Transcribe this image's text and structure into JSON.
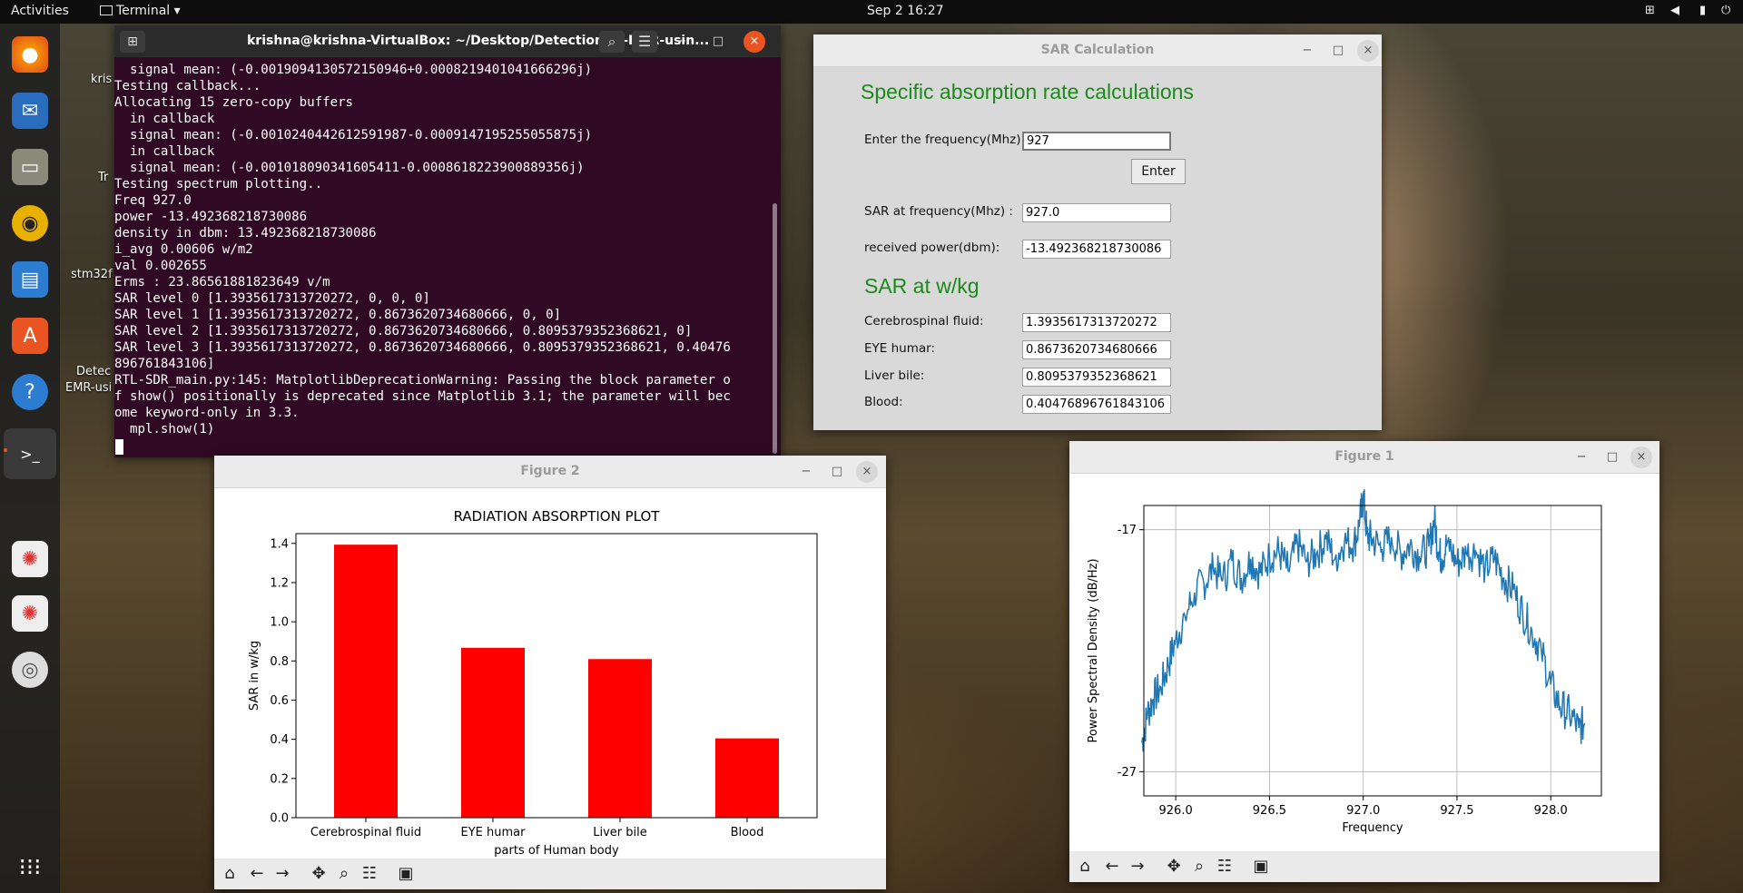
{
  "topbar": {
    "activities": "Activities",
    "app": "Terminal ▾",
    "clock": "Sep 2  16:27"
  },
  "desktop_icons": [
    {
      "label": "kris"
    },
    {
      "label": "Tr"
    },
    {
      "label": "stm32f"
    },
    {
      "label": "Detec"
    },
    {
      "label": "EMR-usi"
    }
  ],
  "terminal": {
    "title": "krishna@krishna-VirtualBox: ~/Desktop/Detection-of-EMR-usin...",
    "lines": [
      "  signal mean: (-0.0019094130572150946+0.0008219401041666296j)",
      "Testing callback...",
      "Allocating 15 zero-copy buffers",
      "  in callback",
      "  signal mean: (-0.0010240442612591987-0.0009147195255055875j)",
      "  in callback",
      "  signal mean: (-0.001018090341605411-0.0008618223900889356j)",
      "Testing spectrum plotting..",
      "Freq 927.0",
      "power -13.492368218730086",
      "density in dbm: 13.492368218730086",
      "i_avg 0.00606 w/m2",
      "val 0.002655",
      "Erms : 23.86561881823649 v/m",
      "SAR level 0 [1.3935617313720272, 0, 0, 0]",
      "SAR level 1 [1.3935617313720272, 0.8673620734680666, 0, 0]",
      "SAR level 2 [1.3935617313720272, 0.8673620734680666, 0.8095379352368621, 0]",
      "SAR level 3 [1.3935617313720272, 0.8673620734680666, 0.8095379352368621, 0.40476",
      "896761843106]",
      "RTL-SDR_main.py:145: MatplotlibDeprecationWarning: Passing the block parameter o",
      "f show() positionally is deprecated since Matplotlib 3.1; the parameter will bec",
      "ome keyword-only in 3.3.",
      "  mpl.show(1)"
    ]
  },
  "sar_window": {
    "title": "SAR Calculation",
    "heading": "Specific absorption rate calculations",
    "freq_label": "Enter the frequency(Mhz):",
    "freq_value": "927",
    "enter_button": "Enter",
    "sar_freq_label": "SAR at frequency(Mhz) :",
    "sar_freq_value": "927.0",
    "power_label": "received power(dbm):",
    "power_value": "-13.492368218730086",
    "subheading": "SAR at w/kg",
    "rows": [
      {
        "label": "Cerebrospinal fluid:",
        "value": "1.3935617313720272"
      },
      {
        "label": "EYE humar:",
        "value": "0.8673620734680666"
      },
      {
        "label": "Liver bile:",
        "value": "0.8095379352368621"
      },
      {
        "label": "Blood:",
        "value": "0.40476896761843106"
      }
    ]
  },
  "figure2": {
    "title": "Figure 2"
  },
  "figure1": {
    "title": "Figure 1"
  },
  "chart_data": [
    {
      "type": "bar",
      "title": "RADIATION ABSORPTION PLOT",
      "xlabel": "parts of Human body",
      "ylabel": "SAR in w/kg",
      "categories": [
        "Cerebrospinal fluid",
        "EYE humar",
        "Liver bile",
        "Blood"
      ],
      "values": [
        1.3935617313720272,
        0.8673620734680666,
        0.8095379352368621,
        0.40476896761843106
      ],
      "ylim": [
        0,
        1.45
      ],
      "yticks": [
        "0.0",
        "0.2",
        "0.4",
        "0.6",
        "0.8",
        "1.0",
        "1.2",
        "1.4"
      ],
      "bar_color": "#ff0000",
      "grid": false
    },
    {
      "type": "line",
      "title": "",
      "xlabel": "Frequency",
      "ylabel": "Power Spectral Density (dB/Hz)",
      "xlim": [
        925.83,
        928.27
      ],
      "ylim": [
        -28.0,
        -16.0
      ],
      "xticks": [
        "926.0",
        "926.5",
        "927.0",
        "927.5",
        "928.0"
      ],
      "yticks": [
        "-17",
        "-27"
      ],
      "line_color": "#1f77b4",
      "grid": true,
      "x": [
        925.82,
        925.85,
        925.88,
        925.92,
        925.96,
        926.0,
        926.05,
        926.1,
        926.15,
        926.2,
        926.25,
        926.3,
        926.35,
        926.4,
        926.45,
        926.5,
        926.55,
        926.6,
        926.65,
        926.7,
        926.75,
        926.8,
        926.85,
        926.9,
        926.95,
        926.98,
        927.0,
        927.02,
        927.05,
        927.1,
        927.15,
        927.2,
        927.25,
        927.3,
        927.35,
        927.38,
        927.4,
        927.42,
        927.45,
        927.5,
        927.55,
        927.6,
        927.65,
        927.7,
        927.75,
        927.8,
        927.85,
        927.9,
        927.95,
        928.0,
        928.05,
        928.1,
        928.15,
        928.18
      ],
      "y": [
        -25.8,
        -24.6,
        -24.0,
        -23.5,
        -22.6,
        -21.5,
        -20.6,
        -19.6,
        -19.2,
        -18.6,
        -19.1,
        -18.3,
        -19.0,
        -18.2,
        -18.8,
        -18.1,
        -17.9,
        -18.7,
        -17.6,
        -18.3,
        -18.0,
        -17.4,
        -18.2,
        -17.5,
        -17.6,
        -16.8,
        -15.6,
        -17.2,
        -17.4,
        -17.8,
        -17.3,
        -18.0,
        -17.6,
        -18.1,
        -17.7,
        -16.6,
        -17.9,
        -18.2,
        -17.5,
        -18.4,
        -18.0,
        -17.9,
        -18.6,
        -18.2,
        -19.0,
        -19.5,
        -20.4,
        -21.2,
        -22.0,
        -23.4,
        -24.3,
        -24.6,
        -25.2,
        -25.0
      ]
    }
  ]
}
